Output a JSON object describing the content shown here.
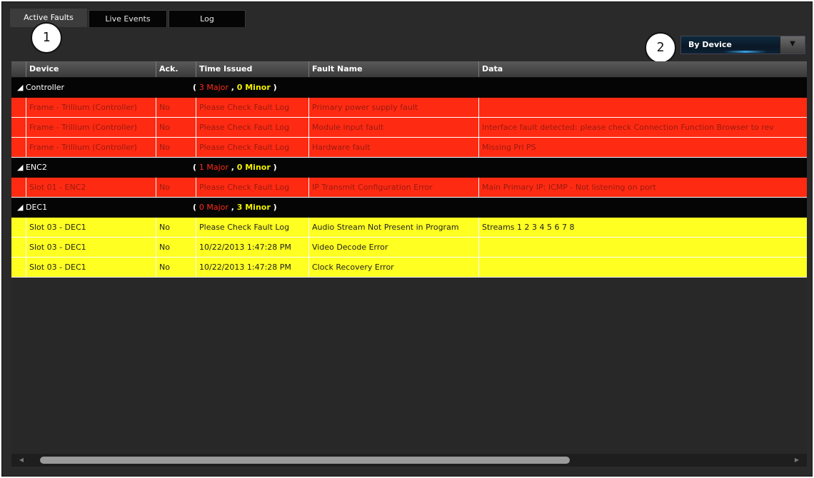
{
  "tabs": [
    {
      "label": "Active Faults"
    },
    {
      "label": "Live Events"
    },
    {
      "label": "Log"
    }
  ],
  "callouts": [
    "1",
    "2"
  ],
  "group_by": {
    "label": "By Device",
    "arrow": "▼"
  },
  "columns": {
    "device": "Device",
    "ack": "Ack.",
    "time": "Time Issued",
    "fault": "Fault Name",
    "data": "Data"
  },
  "groups": [
    {
      "name": "Controller",
      "major": "3 Major",
      "minor": "0 Minor",
      "rows": [
        {
          "device": "Frame - Trillium (Controller)",
          "ack": "No",
          "time": "Please Check Fault Log",
          "fault": "Primary power supply fault",
          "data": ""
        },
        {
          "device": "Frame - Trillium (Controller)",
          "ack": "No",
          "time": "Please Check Fault Log",
          "fault": "Module input fault",
          "data": "Interface fault detected: please check Connection Function Browser to rev"
        },
        {
          "device": "Frame - Trillium (Controller)",
          "ack": "No",
          "time": "Please Check Fault Log",
          "fault": "Hardware fault",
          "data": "Missing Pri PS"
        }
      ]
    },
    {
      "name": "ENC2",
      "major": "1 Major",
      "minor": "0 Minor",
      "rows": [
        {
          "device": "Slot 01 - ENC2",
          "ack": "No",
          "time": "Please Check Fault Log",
          "fault": "IP Transmit Configuration Error",
          "data": "Main Primary IP: ICMP - Not listening on port"
        }
      ]
    },
    {
      "name": "DEC1",
      "major": "0 Major",
      "minor": "3 Minor",
      "rows": [
        {
          "device": "Slot 03 - DEC1",
          "ack": "No",
          "time": "Please Check Fault Log",
          "fault": "Audio Stream Not Present in Program",
          "data": "Streams 1 2 3 4 5 6 7 8"
        },
        {
          "device": "Slot 03 - DEC1",
          "ack": "No",
          "time": "10/22/2013 1:47:28 PM",
          "fault": "Video Decode Error",
          "data": ""
        },
        {
          "device": "Slot 03 - DEC1",
          "ack": "No",
          "time": "10/22/2013 1:47:28 PM",
          "fault": "Clock Recovery Error",
          "data": ""
        }
      ]
    }
  ],
  "colors": {
    "major_row": "#ff2a12",
    "minor_row": "#ffff22",
    "group_row": "#050505"
  },
  "expander_icon": "triangle-expanded-icon"
}
